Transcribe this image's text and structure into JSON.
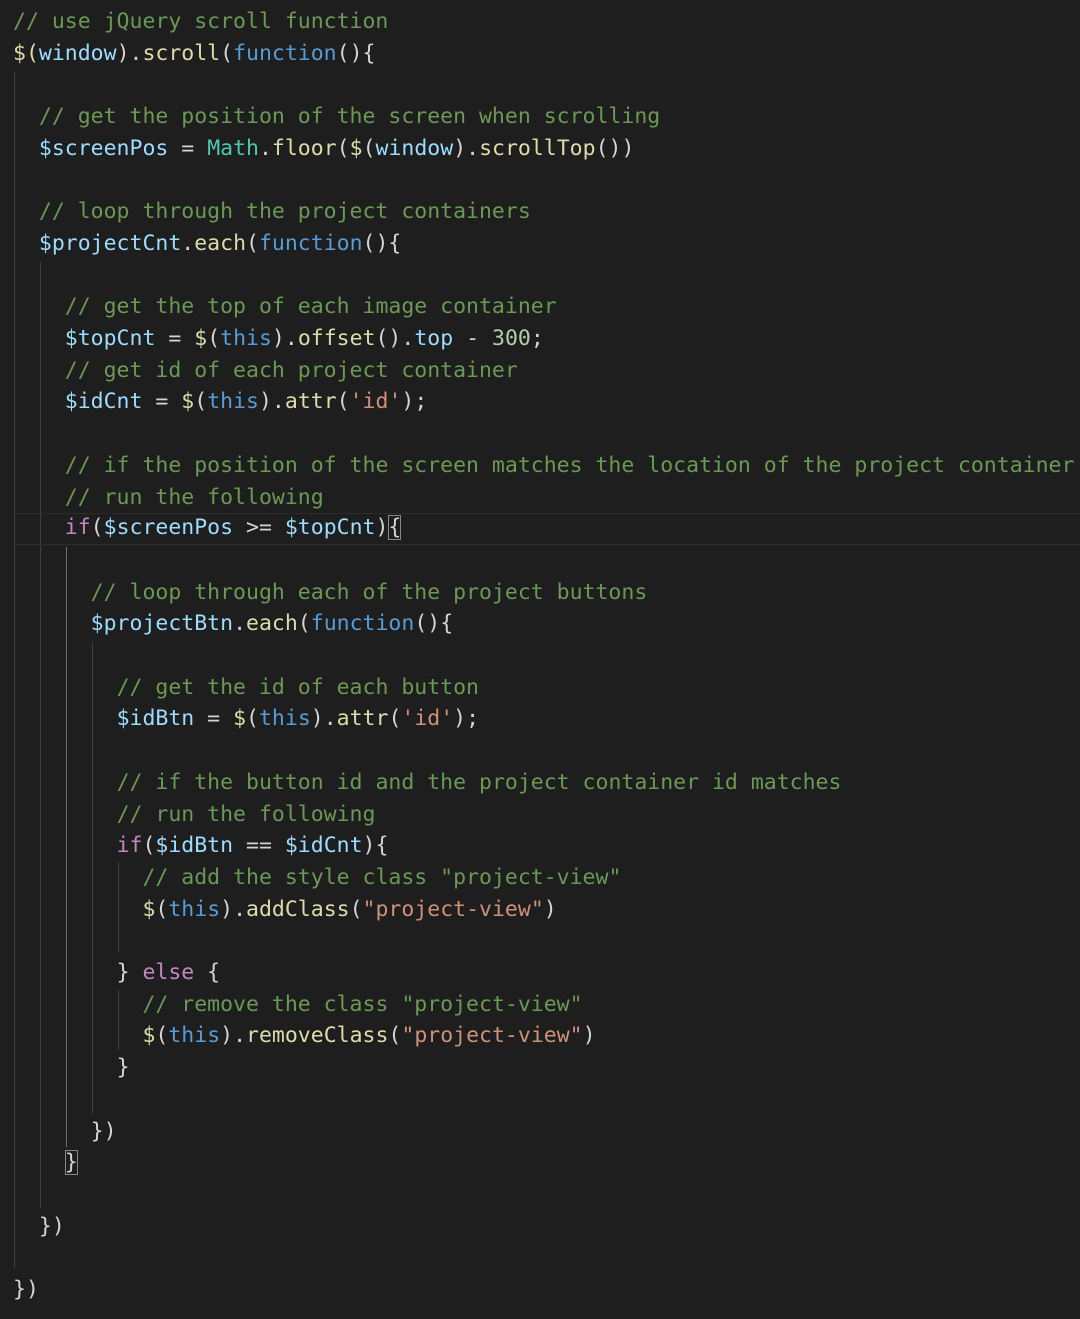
{
  "editor": {
    "language": "javascript",
    "theme_colors": {
      "background": "#1e1e1e",
      "comment": "#6a9955",
      "variable": "#9cdcfe",
      "function": "#dcdcaa",
      "keyword": "#569cd6",
      "control": "#c586c0",
      "string": "#ce9178",
      "number": "#b5cea8",
      "type": "#4ec9b0",
      "punctuation": "#d4d4d4"
    },
    "lines": [
      [
        {
          "t": "// use jQuery scroll function",
          "c": "comment"
        }
      ],
      [
        {
          "t": "$(",
          "c": "fn"
        },
        {
          "t": "window",
          "c": "var"
        },
        {
          "t": ").",
          "c": "punc"
        },
        {
          "t": "scroll",
          "c": "fn"
        },
        {
          "t": "(",
          "c": "punc"
        },
        {
          "t": "function",
          "c": "kw"
        },
        {
          "t": "(){",
          "c": "punc"
        }
      ],
      [],
      [
        {
          "t": "  "
        },
        {
          "t": "// get the position of the screen when scrolling",
          "c": "comment"
        }
      ],
      [
        {
          "t": "  "
        },
        {
          "t": "$screenPos",
          "c": "var"
        },
        {
          "t": " = ",
          "c": "punc"
        },
        {
          "t": "Math",
          "c": "type"
        },
        {
          "t": ".",
          "c": "punc"
        },
        {
          "t": "floor",
          "c": "fn"
        },
        {
          "t": "(",
          "c": "punc"
        },
        {
          "t": "$",
          "c": "fn"
        },
        {
          "t": "(",
          "c": "punc"
        },
        {
          "t": "window",
          "c": "var"
        },
        {
          "t": ").",
          "c": "punc"
        },
        {
          "t": "scrollTop",
          "c": "fn"
        },
        {
          "t": "())",
          "c": "punc"
        }
      ],
      [],
      [
        {
          "t": "  "
        },
        {
          "t": "// loop through the project containers",
          "c": "comment"
        }
      ],
      [
        {
          "t": "  "
        },
        {
          "t": "$projectCnt",
          "c": "var"
        },
        {
          "t": ".",
          "c": "punc"
        },
        {
          "t": "each",
          "c": "fn"
        },
        {
          "t": "(",
          "c": "punc"
        },
        {
          "t": "function",
          "c": "kw"
        },
        {
          "t": "(){",
          "c": "punc"
        }
      ],
      [],
      [
        {
          "t": "    "
        },
        {
          "t": "// get the top of each image container",
          "c": "comment"
        }
      ],
      [
        {
          "t": "    "
        },
        {
          "t": "$topCnt",
          "c": "var"
        },
        {
          "t": " = ",
          "c": "punc"
        },
        {
          "t": "$",
          "c": "fn"
        },
        {
          "t": "(",
          "c": "punc"
        },
        {
          "t": "this",
          "c": "kw"
        },
        {
          "t": ").",
          "c": "punc"
        },
        {
          "t": "offset",
          "c": "fn"
        },
        {
          "t": "().",
          "c": "punc"
        },
        {
          "t": "top",
          "c": "var"
        },
        {
          "t": " - ",
          "c": "punc"
        },
        {
          "t": "300",
          "c": "num"
        },
        {
          "t": ";",
          "c": "punc"
        }
      ],
      [
        {
          "t": "    "
        },
        {
          "t": "// get id of each project container",
          "c": "comment"
        }
      ],
      [
        {
          "t": "    "
        },
        {
          "t": "$idCnt",
          "c": "var"
        },
        {
          "t": " = ",
          "c": "punc"
        },
        {
          "t": "$",
          "c": "fn"
        },
        {
          "t": "(",
          "c": "punc"
        },
        {
          "t": "this",
          "c": "kw"
        },
        {
          "t": ").",
          "c": "punc"
        },
        {
          "t": "attr",
          "c": "fn"
        },
        {
          "t": "(",
          "c": "punc"
        },
        {
          "t": "'id'",
          "c": "str"
        },
        {
          "t": ");",
          "c": "punc"
        }
      ],
      [],
      [
        {
          "t": "    "
        },
        {
          "t": "// if the position of the screen matches the location of the project container",
          "c": "comment"
        }
      ],
      [
        {
          "t": "    "
        },
        {
          "t": "// run the following",
          "c": "comment"
        }
      ],
      [
        {
          "t": "    "
        },
        {
          "t": "if",
          "c": "ctrl"
        },
        {
          "t": "(",
          "c": "punc"
        },
        {
          "t": "$screenPos",
          "c": "var"
        },
        {
          "t": " >= ",
          "c": "punc"
        },
        {
          "t": "$topCnt",
          "c": "var"
        },
        {
          "t": ")",
          "c": "punc"
        },
        {
          "t": "{",
          "c": "punc",
          "m": true
        }
      ],
      [],
      [
        {
          "t": "      "
        },
        {
          "t": "// loop through each of the project buttons",
          "c": "comment"
        }
      ],
      [
        {
          "t": "      "
        },
        {
          "t": "$projectBtn",
          "c": "var"
        },
        {
          "t": ".",
          "c": "punc"
        },
        {
          "t": "each",
          "c": "fn"
        },
        {
          "t": "(",
          "c": "punc"
        },
        {
          "t": "function",
          "c": "kw"
        },
        {
          "t": "(){",
          "c": "punc"
        }
      ],
      [],
      [
        {
          "t": "        "
        },
        {
          "t": "// get the id of each button",
          "c": "comment"
        }
      ],
      [
        {
          "t": "        "
        },
        {
          "t": "$idBtn",
          "c": "var"
        },
        {
          "t": " = ",
          "c": "punc"
        },
        {
          "t": "$",
          "c": "fn"
        },
        {
          "t": "(",
          "c": "punc"
        },
        {
          "t": "this",
          "c": "kw"
        },
        {
          "t": ").",
          "c": "punc"
        },
        {
          "t": "attr",
          "c": "fn"
        },
        {
          "t": "(",
          "c": "punc"
        },
        {
          "t": "'id'",
          "c": "str"
        },
        {
          "t": ");",
          "c": "punc"
        }
      ],
      [],
      [
        {
          "t": "        "
        },
        {
          "t": "// if the button id and the project container id matches",
          "c": "comment"
        }
      ],
      [
        {
          "t": "        "
        },
        {
          "t": "// run the following",
          "c": "comment"
        }
      ],
      [
        {
          "t": "        "
        },
        {
          "t": "if",
          "c": "ctrl"
        },
        {
          "t": "(",
          "c": "punc"
        },
        {
          "t": "$idBtn",
          "c": "var"
        },
        {
          "t": " == ",
          "c": "punc"
        },
        {
          "t": "$idCnt",
          "c": "var"
        },
        {
          "t": "){",
          "c": "punc"
        }
      ],
      [
        {
          "t": "          "
        },
        {
          "t": "// add the style class \"project-view\"",
          "c": "comment"
        }
      ],
      [
        {
          "t": "          "
        },
        {
          "t": "$",
          "c": "fn"
        },
        {
          "t": "(",
          "c": "punc"
        },
        {
          "t": "this",
          "c": "kw"
        },
        {
          "t": ").",
          "c": "punc"
        },
        {
          "t": "addClass",
          "c": "fn"
        },
        {
          "t": "(",
          "c": "punc"
        },
        {
          "t": "\"project-view\"",
          "c": "str"
        },
        {
          "t": ")",
          "c": "punc"
        }
      ],
      [],
      [
        {
          "t": "        "
        },
        {
          "t": "} ",
          "c": "punc"
        },
        {
          "t": "else",
          "c": "ctrl"
        },
        {
          "t": " {",
          "c": "punc"
        }
      ],
      [
        {
          "t": "          "
        },
        {
          "t": "// remove the class \"project-view\"",
          "c": "comment"
        }
      ],
      [
        {
          "t": "          "
        },
        {
          "t": "$",
          "c": "fn"
        },
        {
          "t": "(",
          "c": "punc"
        },
        {
          "t": "this",
          "c": "kw"
        },
        {
          "t": ").",
          "c": "punc"
        },
        {
          "t": "removeClass",
          "c": "fn"
        },
        {
          "t": "(",
          "c": "punc"
        },
        {
          "t": "\"project-view\"",
          "c": "str"
        },
        {
          "t": ")",
          "c": "punc"
        }
      ],
      [
        {
          "t": "        "
        },
        {
          "t": "}",
          "c": "punc"
        }
      ],
      [],
      [
        {
          "t": "      "
        },
        {
          "t": "})",
          "c": "punc"
        }
      ],
      [
        {
          "t": "    "
        },
        {
          "t": "}",
          "c": "punc",
          "m": true
        }
      ],
      [],
      [
        {
          "t": "  "
        },
        {
          "t": "})",
          "c": "punc"
        }
      ],
      [],
      [
        {
          "t": "})",
          "c": "punc"
        }
      ]
    ],
    "current_line": 16
  }
}
